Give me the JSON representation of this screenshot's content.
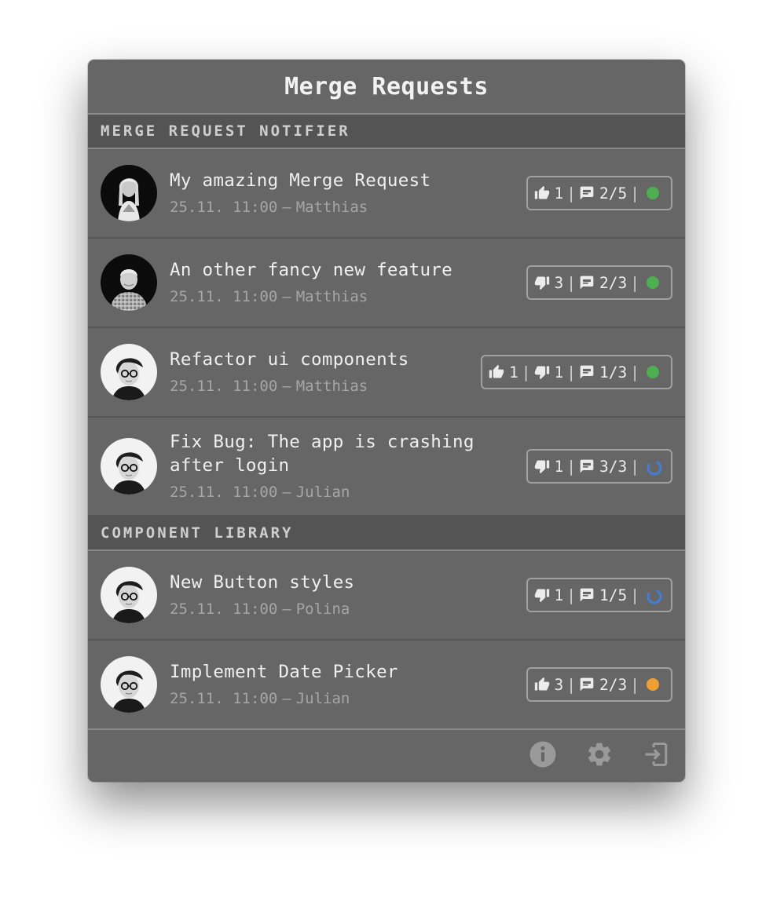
{
  "app": {
    "title": "Merge Requests"
  },
  "colors": {
    "ok": "#4caf50",
    "warning": "#f0a030",
    "pending": "#3f7fd9"
  },
  "sections": [
    {
      "name": "MERGE REQUEST NOTIFIER",
      "items": [
        {
          "title": "My amazing Merge Request",
          "date": "25.11. 11:00",
          "author": "Matthias",
          "thumbs_up": "1",
          "thumbs_down": null,
          "comments": "2/5",
          "status": "ok",
          "avatar": "woman-blonde"
        },
        {
          "title": "An other fancy new feature",
          "date": "25.11. 11:00",
          "author": "Matthias",
          "thumbs_up": null,
          "thumbs_down": "3",
          "comments": "2/3",
          "status": "ok",
          "avatar": "man-checked-shirt"
        },
        {
          "title": "Refactor ui components",
          "date": "25.11. 11:00",
          "author": "Matthias",
          "thumbs_up": "1",
          "thumbs_down": "1",
          "comments": "1/3",
          "status": "ok",
          "avatar": "person-glasses"
        },
        {
          "title": "Fix Bug: The app is crashing after login",
          "date": "25.11. 11:00",
          "author": "Julian",
          "thumbs_up": null,
          "thumbs_down": "1",
          "comments": "3/3",
          "status": "pending",
          "avatar": "person-glasses"
        }
      ]
    },
    {
      "name": "COMPONENT LIBRARY",
      "items": [
        {
          "title": "New Button styles",
          "date": "25.11. 11:00",
          "author": "Polina",
          "thumbs_up": null,
          "thumbs_down": "1",
          "comments": "1/5",
          "status": "pending",
          "avatar": "person-glasses"
        },
        {
          "title": "Implement Date Picker",
          "date": "25.11. 11:00",
          "author": "Julian",
          "thumbs_up": "3",
          "thumbs_down": null,
          "comments": "2/3",
          "status": "warning",
          "avatar": "person-glasses"
        }
      ]
    }
  ],
  "footer": {
    "icons": [
      "info-icon",
      "settings-icon",
      "logout-icon"
    ]
  },
  "meta_separator": "—"
}
